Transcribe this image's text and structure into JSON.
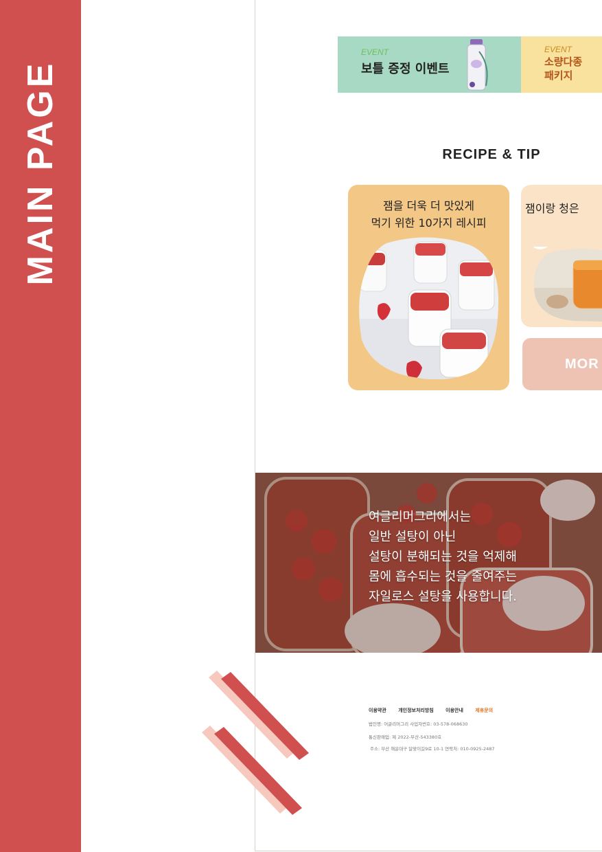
{
  "side": {
    "title": "MAIN PAGE"
  },
  "events": [
    {
      "tag": "EVENT",
      "title": "보틀 증정 이벤트"
    },
    {
      "tag": "EVENT",
      "title_line1": "소량다종",
      "title_line2": "패키지"
    }
  ],
  "recipe": {
    "title": "RECIPE & TIP",
    "cards": [
      {
        "line1": "잼을 더욱 더 맛있게",
        "line2": "먹기 위한 10가지 레시피"
      },
      {
        "line1": "잼이랑 청은"
      }
    ],
    "more_label": "MOR"
  },
  "hero": {
    "lines": [
      "여글리머그리에서는",
      "일반 설탕이 아닌",
      "설탕이 분해되는 것을 억제해",
      "몸에 흡수되는 것을 줄여주는",
      "자일로스 설탕을 사용합니다."
    ]
  },
  "footer": {
    "links": [
      "이용약관",
      "개인정보처리방침",
      "이용안내",
      "제휴문의"
    ],
    "info": [
      "법인명: 어글리머그리 사업자번호: 03-578-068630",
      "통신판매업: 제 2022-부산-543380호",
      "주소: 부산 해운대구 달맞이길9로 10-1 연락처: 010-0925-2487"
    ]
  },
  "colors": {
    "sidebar": "#d05050",
    "banner_green": "#a8d9c4",
    "banner_yellow": "#f8e29e",
    "card_orange": "#f3c786",
    "card_peach": "#fbe3c8",
    "more_button": "#efc3b3",
    "footer_highlight": "#e07a2b"
  }
}
